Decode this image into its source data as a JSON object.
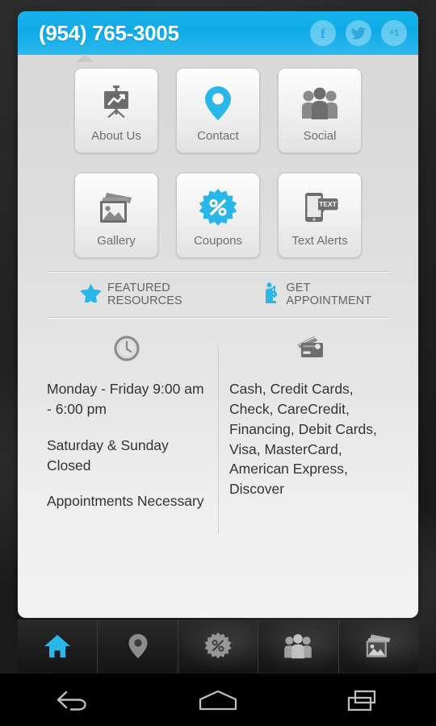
{
  "header": {
    "phone": "(954) 765-3005",
    "social": [
      {
        "name": "facebook",
        "label": "f"
      },
      {
        "name": "twitter",
        "label": ""
      },
      {
        "name": "google-plus",
        "label": "+1"
      }
    ]
  },
  "grid": {
    "tiles": [
      {
        "icon": "presentation-chart-icon",
        "label": "About Us"
      },
      {
        "icon": "map-pin-icon",
        "label": "Contact"
      },
      {
        "icon": "people-group-icon",
        "label": "Social"
      },
      {
        "icon": "photo-gallery-icon",
        "label": "Gallery"
      },
      {
        "icon": "percent-burst-icon",
        "label": "Coupons"
      },
      {
        "icon": "phone-text-icon",
        "label": "Text Alerts"
      }
    ]
  },
  "featured": {
    "items": [
      {
        "icon": "star-icon",
        "label": "FEATURED RESOURCES"
      },
      {
        "icon": "appointment-person-icon",
        "label": "GET APPOINTMENT"
      }
    ]
  },
  "info": {
    "hours": {
      "icon": "clock-icon",
      "lines": [
        "Monday - Friday 9:00 am - 6:00 pm",
        "Saturday & Sunday Closed",
        "Appointments Necessary"
      ]
    },
    "payments": {
      "icon": "credit-card-icon",
      "text": "Cash, Credit Cards, Check, CareCredit, Financing, Debit Cards, Visa, MasterCard, American Express, Discover"
    }
  },
  "app_nav": {
    "items": [
      {
        "icon": "home-icon",
        "name": "home",
        "active": true
      },
      {
        "icon": "map-pin-icon",
        "name": "location",
        "active": false
      },
      {
        "icon": "percent-burst-icon",
        "name": "coupons",
        "active": false
      },
      {
        "icon": "people-group-icon",
        "name": "social",
        "active": false
      },
      {
        "icon": "photo-gallery-icon",
        "name": "gallery",
        "active": false
      }
    ]
  },
  "system_bar": {
    "buttons": [
      {
        "icon": "back-icon",
        "name": "back"
      },
      {
        "icon": "home-icon",
        "name": "home"
      },
      {
        "icon": "recents-icon",
        "name": "recents"
      }
    ]
  },
  "colors": {
    "brand_blue": "#0fabe6",
    "accent_blue": "#29b6e8",
    "card_bg": "#e4e4e4",
    "icon_gray": "#707070",
    "text_dark": "#343434",
    "text_muted": "#6e6e6e"
  }
}
